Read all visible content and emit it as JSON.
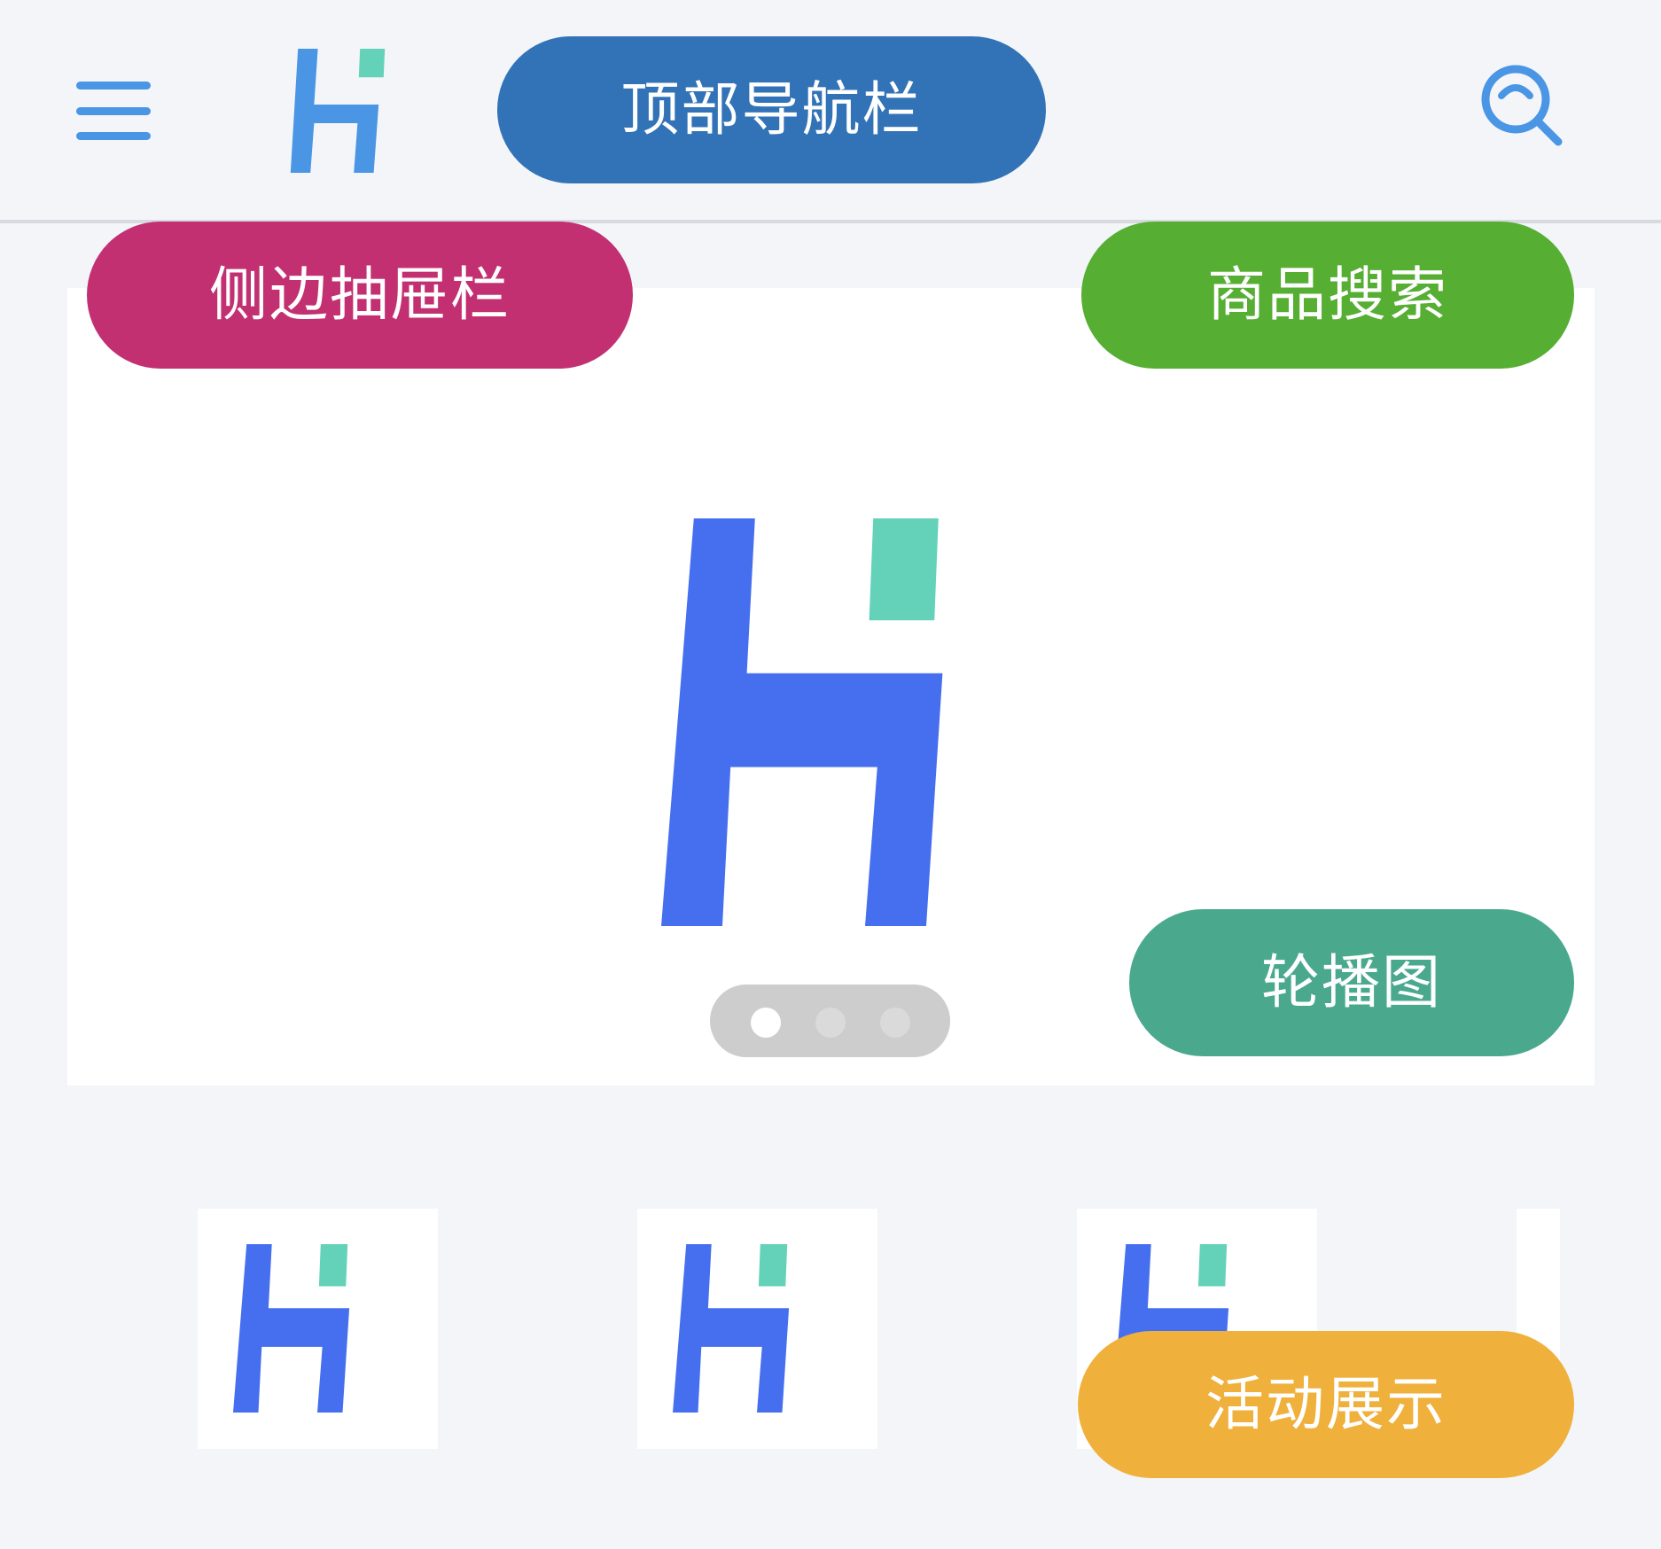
{
  "annotations": {
    "top_nav": "顶部导航栏",
    "side_drawer": "侧边抽屉栏",
    "product_search": "商品搜索",
    "carousel": "轮播图",
    "activity_display": "活动展示"
  },
  "topbar": {
    "menu_icon": "hamburger-menu-icon",
    "logo": "h-logo",
    "search_icon": "search-icon"
  },
  "carousel": {
    "slide_count": 3,
    "active_slide": 1
  },
  "activities": {
    "visible_tiles": 4
  },
  "colors": {
    "background": "#f3f5f9",
    "nav_icon": "#4a95e4",
    "logo_blue": "#456fef",
    "logo_teal": "#64d2b9",
    "pill_nav": "#3273b7",
    "pill_drawer": "#c23072",
    "pill_search": "#56ae33",
    "pill_carousel": "#4aa98d",
    "pill_activity": "#efb03c"
  }
}
